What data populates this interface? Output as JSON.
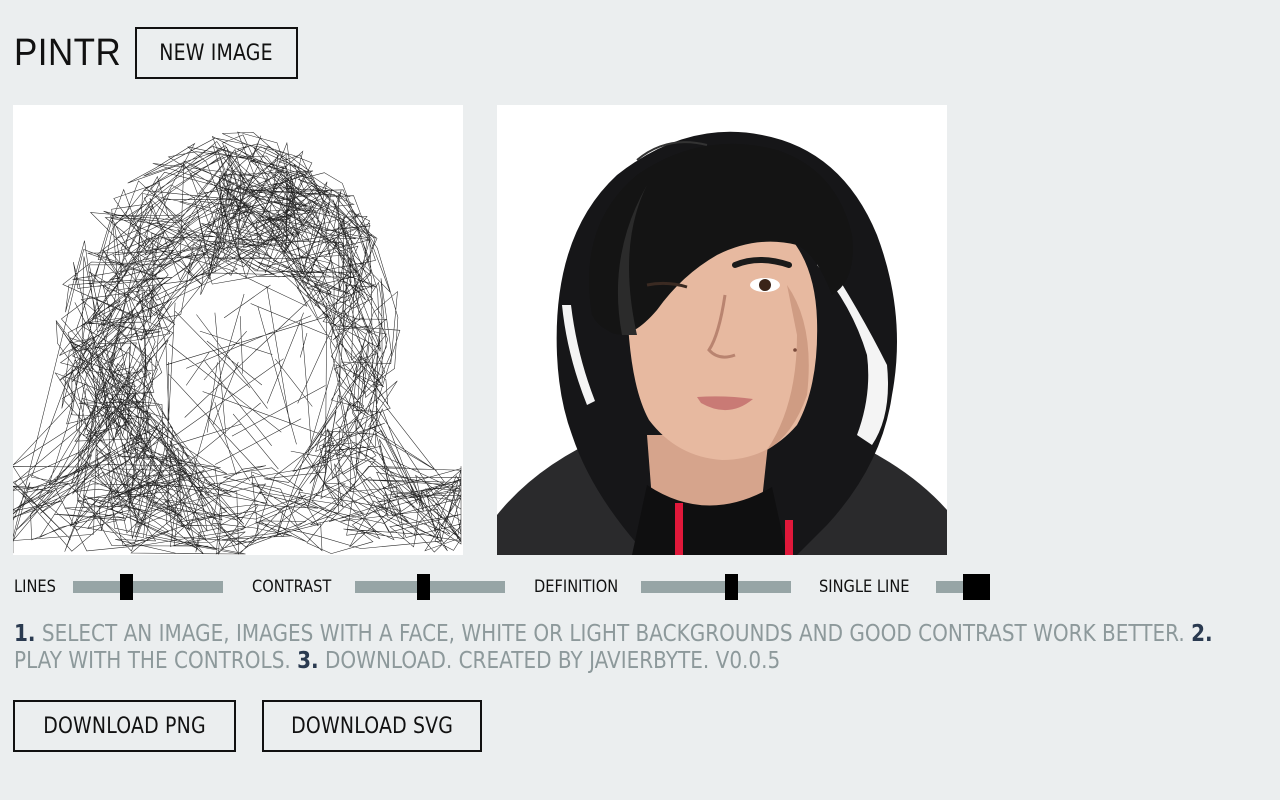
{
  "app": {
    "title": "PINTR",
    "new_image_label": "NEW IMAGE"
  },
  "controls": {
    "lines": {
      "label": "LINES",
      "value": 0.35
    },
    "contrast": {
      "label": "CONTRAST",
      "value": 0.45
    },
    "definition": {
      "label": "DEFINITION",
      "value": 0.6
    },
    "single_line": {
      "label": "SINGLE LINE",
      "on": true
    }
  },
  "instructions": {
    "step1_num": "1.",
    "step1_text": " SELECT AN IMAGE, IMAGES WITH A FACE, WHITE OR LIGHT BACKGROUNDS AND GOOD CONTRAST WORK BETTER. ",
    "step2_num": "2.",
    "step2_text": " PLAY WITH THE CONTROLS. ",
    "step3_num": "3.",
    "step3_text": " DOWNLOAD. CREATED BY JAVIERBYTE. V0.0.5"
  },
  "downloads": {
    "png_label": "DOWNLOAD PNG",
    "svg_label": "DOWNLOAD SVG"
  },
  "colors": {
    "background": "#ebeeef",
    "track": "#97a5a6",
    "instruction_text": "#8d999b",
    "step_number": "#2a3a50",
    "hoodie": "#1c1c1e",
    "drawstring": "#e0183a",
    "skin": "#e7b9a0"
  }
}
